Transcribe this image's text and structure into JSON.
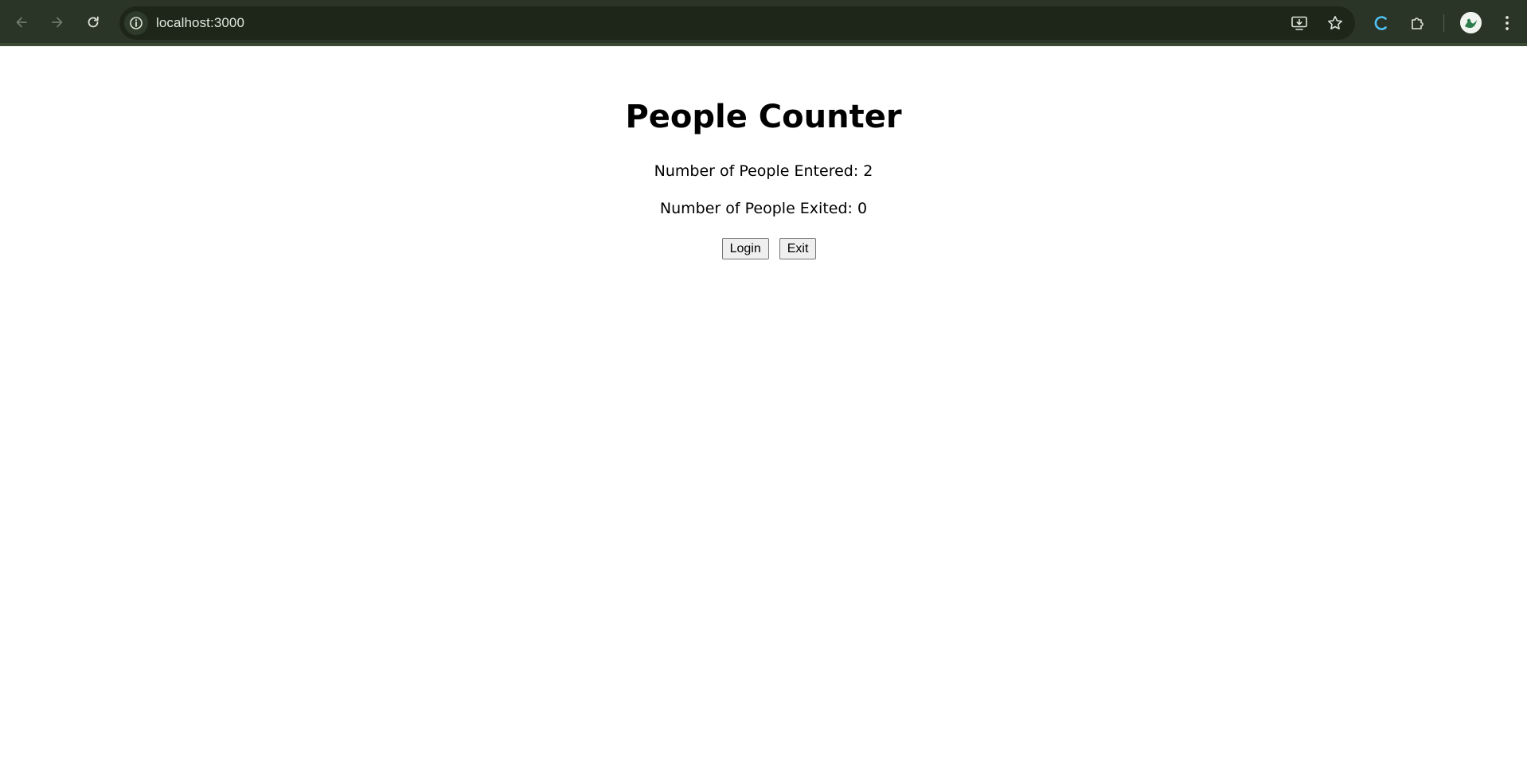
{
  "browser": {
    "url": "localhost:3000",
    "colors": {
      "toolbar_bg": "#2b3527",
      "omnibox_bg": "#1d2619",
      "url_text": "#e4e8df",
      "reload_spinner": "#4fc3f7"
    },
    "icons": {
      "back": "arrow-left-icon",
      "forward": "arrow-right-icon",
      "reload": "reload-icon",
      "site_info": "info-icon",
      "install": "install-app-icon",
      "bookmark": "star-icon",
      "loading": "loading-spinner-icon",
      "extensions": "puzzle-icon",
      "profile": "avatar",
      "menu": "kebab-menu-icon"
    }
  },
  "page": {
    "title": "People Counter",
    "entered_text": "Number of People Entered: 2",
    "exited_text": "Number of People Exited: 0",
    "entered_count": 2,
    "exited_count": 0,
    "login_label": "Login",
    "exit_label": "Exit"
  }
}
